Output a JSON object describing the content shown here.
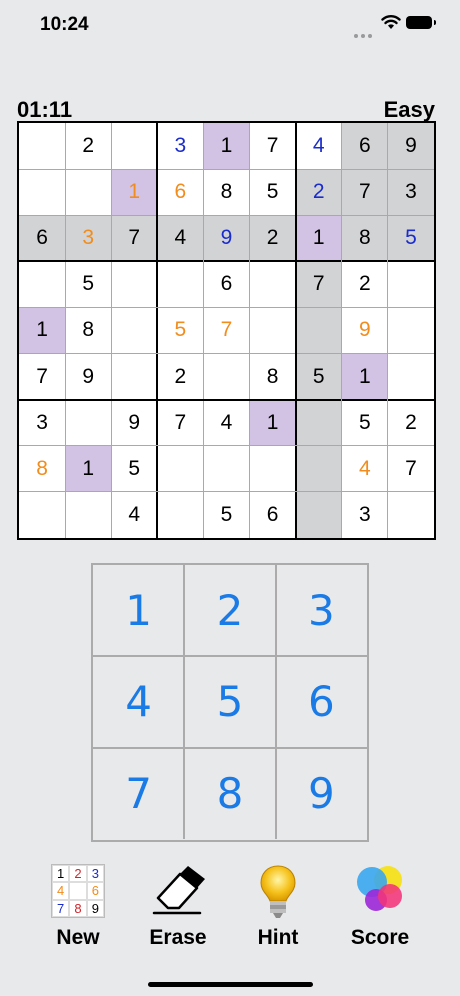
{
  "status": {
    "time": "10:24"
  },
  "header": {
    "timer": "01:11",
    "difficulty": "Easy"
  },
  "colors": {
    "given": "#000000",
    "blue": "#1a2ccc",
    "orange": "#f28c1c",
    "highlight_gray": "#d2d3d5",
    "highlight_purple": "#d2c2e3",
    "key": "#1a7ae6"
  },
  "board": [
    [
      [
        "",
        ""
      ],
      [
        "2",
        "g"
      ],
      [
        "",
        ""
      ],
      [
        "3",
        "b"
      ],
      [
        "1",
        "g"
      ],
      [
        "7",
        "g"
      ],
      [
        "4",
        "b"
      ],
      [
        "6",
        "g"
      ],
      [
        "9",
        "g"
      ]
    ],
    [
      [
        "",
        ""
      ],
      [
        "",
        ""
      ],
      [
        "1",
        "o"
      ],
      [
        "6",
        "o"
      ],
      [
        "8",
        "g"
      ],
      [
        "5",
        "g"
      ],
      [
        "2",
        "b"
      ],
      [
        "7",
        "g"
      ],
      [
        "3",
        "g"
      ]
    ],
    [
      [
        "6",
        "g"
      ],
      [
        "3",
        "o"
      ],
      [
        "7",
        "g"
      ],
      [
        "4",
        "g"
      ],
      [
        "9",
        "b"
      ],
      [
        "2",
        "g"
      ],
      [
        "1",
        "g"
      ],
      [
        "8",
        "g"
      ],
      [
        "5",
        "b"
      ]
    ],
    [
      [
        "",
        ""
      ],
      [
        "5",
        "g"
      ],
      [
        "",
        ""
      ],
      [
        "",
        ""
      ],
      [
        "6",
        "g"
      ],
      [
        "",
        ""
      ],
      [
        "7",
        "g"
      ],
      [
        "2",
        "g"
      ],
      [
        "",
        ""
      ]
    ],
    [
      [
        "1",
        "g"
      ],
      [
        "8",
        "g"
      ],
      [
        "",
        ""
      ],
      [
        "5",
        "o"
      ],
      [
        "7",
        "o"
      ],
      [
        "",
        ""
      ],
      [
        "",
        ""
      ],
      [
        "9",
        "o"
      ],
      [
        "",
        ""
      ]
    ],
    [
      [
        "7",
        "g"
      ],
      [
        "9",
        "g"
      ],
      [
        "",
        ""
      ],
      [
        "2",
        "g"
      ],
      [
        "",
        ""
      ],
      [
        "8",
        "g"
      ],
      [
        "5",
        "g"
      ],
      [
        "1",
        "g"
      ],
      [
        "",
        ""
      ]
    ],
    [
      [
        "3",
        "g"
      ],
      [
        "",
        ""
      ],
      [
        "9",
        "g"
      ],
      [
        "7",
        "g"
      ],
      [
        "4",
        "g"
      ],
      [
        "1",
        "g"
      ],
      [
        "",
        ""
      ],
      [
        "5",
        "g"
      ],
      [
        "2",
        "g"
      ]
    ],
    [
      [
        "8",
        "o"
      ],
      [
        "1",
        "g"
      ],
      [
        "5",
        "g"
      ],
      [
        "",
        ""
      ],
      [
        "",
        ""
      ],
      [
        "",
        ""
      ],
      [
        "",
        ""
      ],
      [
        "4",
        "o"
      ],
      [
        "7",
        "g"
      ]
    ],
    [
      [
        "",
        ""
      ],
      [
        "",
        ""
      ],
      [
        "4",
        "g"
      ],
      [
        "",
        ""
      ],
      [
        "5",
        "g"
      ],
      [
        "6",
        "g"
      ],
      [
        "",
        ""
      ],
      [
        "3",
        "g"
      ],
      [
        "",
        ""
      ]
    ]
  ],
  "highlights": {
    "gray": [
      [
        0,
        7
      ],
      [
        0,
        8
      ],
      [
        1,
        6
      ],
      [
        1,
        7
      ],
      [
        1,
        8
      ],
      [
        2,
        0
      ],
      [
        2,
        1
      ],
      [
        2,
        2
      ],
      [
        2,
        3
      ],
      [
        2,
        4
      ],
      [
        2,
        5
      ],
      [
        2,
        7
      ],
      [
        2,
        8
      ],
      [
        3,
        6
      ],
      [
        4,
        6
      ],
      [
        5,
        6
      ],
      [
        6,
        6
      ],
      [
        7,
        6
      ],
      [
        8,
        6
      ]
    ],
    "purple": [
      [
        0,
        4
      ],
      [
        1,
        2
      ],
      [
        2,
        6
      ],
      [
        4,
        0
      ],
      [
        5,
        7
      ],
      [
        6,
        5
      ],
      [
        7,
        1
      ]
    ]
  },
  "keypad": [
    "1",
    "2",
    "3",
    "4",
    "5",
    "6",
    "7",
    "8",
    "9"
  ],
  "new_icon_digits": [
    [
      "1",
      "#000000"
    ],
    [
      "2",
      "#d0242a"
    ],
    [
      "3",
      "#1a2ccc"
    ],
    [
      "4",
      "#f28c1c"
    ],
    [
      "",
      ""
    ],
    [
      "6",
      "#f28c1c"
    ],
    [
      "7",
      "#1a2ccc"
    ],
    [
      "8",
      "#d0242a"
    ],
    [
      "9",
      "#000000"
    ]
  ],
  "toolbar": {
    "new": "New",
    "erase": "Erase",
    "hint": "Hint",
    "score": "Score"
  }
}
